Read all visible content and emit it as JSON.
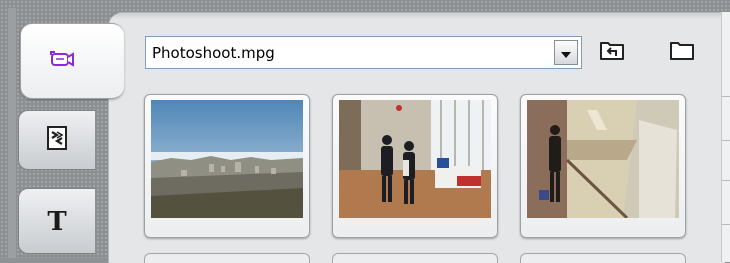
{
  "media_browser": {
    "tabs": [
      {
        "icon": "video-camera-icon",
        "active": true
      },
      {
        "icon": "transitions-icon",
        "active": false
      },
      {
        "icon": "title-text-icon",
        "label": "T",
        "active": false
      }
    ],
    "file_select": {
      "value": "Photoshoot.mpg"
    },
    "toolbar": [
      {
        "icon": "folder-up-icon"
      },
      {
        "icon": "folder-icon"
      }
    ],
    "thumbnails": [
      {
        "scene": "city-skyline"
      },
      {
        "scene": "office-people"
      },
      {
        "scene": "stairway-person"
      }
    ]
  },
  "colors": {
    "accent_purple": "#8a2bd6",
    "panel": "#e4e6e8",
    "backdrop": "#8f9294"
  }
}
